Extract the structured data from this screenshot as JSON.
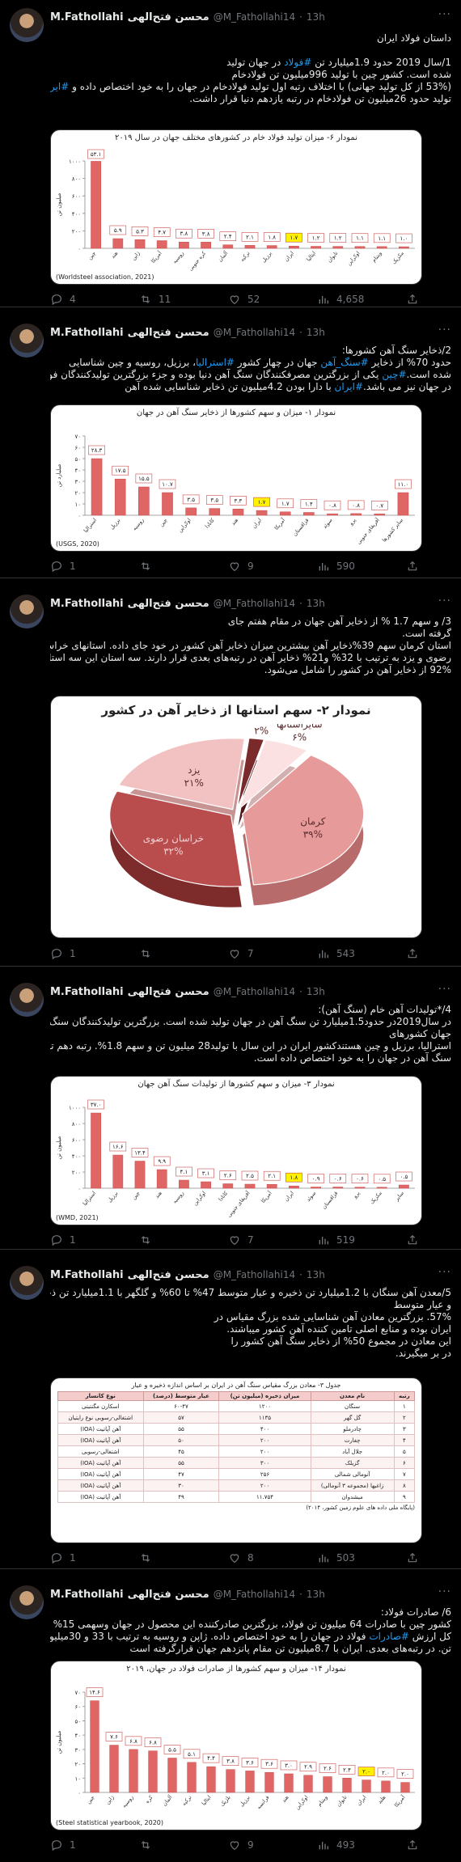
{
  "author": {
    "name": "M.Fathollahi",
    "display": "محسن فتح‌الهی",
    "handle": "@M_Fathollahi14",
    "time": "13h",
    "sep": "·"
  },
  "colors": {
    "bar": "#e06666",
    "bar_edge": "#c94b4b",
    "highlight": "#fff200",
    "link": "#1d9bf0"
  },
  "tweets": [
    {
      "text_lines": [
        "داستان فولاد ایران",
        "",
        "1/سال 2019 حدود 1.9میلیارد تن #فولاد در جهان تولید",
        "شده است. کشور چین با تولید 996میلیون تن فولادخام",
        "(53% از کل تولید جهانی) با اختلاف رتبه اول تولید فولادخام در جهان را به خود اختصاص داده و #ایران با",
        "تولید حدود 26میلیون تن فولادخام در رتبه یازدهم دنیا قرار داشت."
      ],
      "chart_title": "نمودار ۶- میزان تولید فولاد خام در کشورهای مختلف جهان در سال ۲۰۱۹",
      "source": "(Worldsteel association, 2021)",
      "metrics": {
        "reply": "4",
        "retweet": "11",
        "like": "52",
        "views": "4,658"
      }
    },
    {
      "text_lines": [
        "2/ذخایر سنگ آهن کشورها:",
        "حدود 70% از ذخایر #سنگ_آهن جهان در چهار کشور #استرالیا، برزیل، روسیه و چین شناسایی",
        "شده است.#چین یکی از بزرگترین مصرفکنندگان سنگ آهن دنیا بوده و جزء بزرگترین تولیدکنندگان فولاد",
        "در جهان نیز می باشد.#ایران با دارا بودن 4.2میلیون تن ذخایر شناسایی شده آهن"
      ],
      "chart_title": "نمودار ۱- میزان و سهم کشورها از ذخایر سنگ آهن در جهان",
      "source": "(USGS, 2020)",
      "metrics": {
        "reply": "1",
        "retweet": "",
        "like": "9",
        "views": "590"
      }
    },
    {
      "text_lines": [
        "3/ و سهم 1.7 % از ذخایر آهن جهان در مقام هفتم جای",
        "گرفته است.",
        "استان کرمان سهم 39%ذخایر آهن بیشترین میزان ذخایر آهن کشور در خود جای داده. استانهای خراسان",
        "رضوی و یزد به ترتیب با 32% و21% ذخایر آهن در رتبه‌های بعدی قرار دارند. سه استان این سه استان در مجموع",
        "92% از ذخایر آهن در کشور را شامل می‌شود."
      ],
      "chart_title": "نمودار ۲- سهم استانها از ذخایر آهن در کشور",
      "metrics": {
        "reply": "1",
        "retweet": "",
        "like": "7",
        "views": "543"
      }
    },
    {
      "text_lines": [
        "4/*تولیدات آهن خام (سنگ آهن):",
        "در سال2019در حدود1.5میلیارد تن سنگ آهن در جهان تولید شده است. بزرگترین تولیدکنندگان سنگ آهن در",
        "جهان کشورهای",
        "استرالیا، برزیل و چین هستندکشور ایران در این سال با تولید28 میلیون تن و سهم 1.8%. رتبه دهم تولید",
        "سنگ آهن در جهان را به خود اختصاص داده است."
      ],
      "chart_title": "نمودار ۳- میزان و سهم کشورها از تولیدات سنگ آهن جهان",
      "source": "(WMD, 2021)",
      "metrics": {
        "reply": "1",
        "retweet": "",
        "like": "7",
        "views": "519"
      }
    },
    {
      "text_lines": [
        "5/معدن آهن سنگان با 1.2میلیارد تن ذخیره و عیار متوسط 47% تا 60% و گلگهر با 1.1میلیارد تن ذخیره",
        "و عیار متوسط",
        "57%. بزرگترین معادن آهن شناسایی شده بزرگ مقیاس در",
        "ایران بوده و منابع اصلی تامین کننده آهن کشور میباشند.",
        "این معادن در مجموع 50% از ذخایر سنگ آهن کشور را",
        "در بر میگیرند."
      ],
      "chart_title": "جدول ۳- معادن بزرگ مقیاس سنگ آهن در ایران بر اساس اندازه ذخیره و عیار",
      "table_headers": [
        "رتبه",
        "نام معدن",
        "میزان ذخیره (میلیون تن)",
        "عیار متوسط (درصد)",
        "نوع کانسار"
      ],
      "table_rows": [
        [
          "۱",
          "سنگان",
          "۱۲۰۰",
          "۶۰-۴۷",
          "اسکارن مگنتیتی"
        ],
        [
          "۲",
          "گل گهر",
          "۱۱۳۵",
          "۵۷",
          "اشتغالی-رسوبی نوع رایتیان"
        ],
        [
          "۳",
          "چادرملو",
          "۴۰۰",
          "۵۵",
          "آهن آپاتیت (IOA)"
        ],
        [
          "۴",
          "چغارت",
          "۲۰۰",
          "۵۰",
          "آهن آپاتیت (IOA)"
        ],
        [
          "۵",
          "جلال آباد",
          "۲۰۰",
          "۴۵",
          "اشتغالی-رسوبی"
        ],
        [
          "۶",
          "گزیلک",
          "۳۰۰",
          "۵۵",
          "آهن آپاتیت (IOA)"
        ],
        [
          "۷",
          "آنومالی شمالی",
          "۲۵۶",
          "۴۷",
          "آهن آپاتیت (IOA)"
        ],
        [
          "۸",
          "زاغیها (مجموعه ۳ آنومالی)",
          "۲۰۰",
          "۳۰",
          "آهن آپاتیت (IOA)"
        ],
        [
          "۹",
          "میشدوان",
          "۱۱.۷۵۴",
          "۴۹",
          "آهن آپاتیت (IOA)"
        ]
      ],
      "table_source": "(پایگاه ملی داده های علوم زمین کشور، ۲۰۱۴)",
      "metrics": {
        "reply": "1",
        "retweet": "",
        "like": "8",
        "views": "503"
      }
    },
    {
      "text_lines": [
        "6/ صادرات فولاد:",
        "کشور چین با صادرات 64 میلیون تن فولاد، بزرگترین صادرکننده این محصول در جهان وسهمی 15% از",
        "کل ارزش #صادرات فولاد در جهان را به خود اختصاص داده. ژاپن و روسیه به ترتیب با 33 و 30میلیون",
        "تن. در رتبه‌های بعدی. ایران با 8.7میلیون تن مقام پانزدهم جهان قرارگرفته است"
      ],
      "chart_title": "نمودار ۱۴- میزان و سهم کشورها از صادرات فولاد در جهان، ۲۰۱۹",
      "source": "(Steel statistical yearbook, 2020)",
      "metrics": {
        "reply": "1",
        "retweet": "",
        "like": "9",
        "views": "493"
      }
    }
  ],
  "chart_data": [
    {
      "type": "bar",
      "title": "نمودار ۶- میزان تولید فولاد خام در کشورهای مختلف جهان در سال ۲۰۱۹",
      "ylabel": "میلیون تن",
      "ylim": [
        0,
        1000
      ],
      "yticks": [
        "۰",
        "۲۰۰",
        "۴۰۰",
        "۶۰۰",
        "۸۰۰",
        "۱۰۰۰"
      ],
      "categories": [
        "چین",
        "هند",
        "ژاپن",
        "آمریکا",
        "روسیه",
        "کره جنوبی",
        "آلمان",
        "ترکیه",
        "برزیل",
        "ایران",
        "ایتالیا",
        "تایوان",
        "اوکراین",
        "ویتنام",
        "مکزیک"
      ],
      "values": [
        996,
        111,
        99,
        88,
        72,
        71,
        40,
        34,
        32,
        26,
        23,
        22,
        21,
        20,
        18
      ],
      "labels": [
        "۵۳.۱",
        "۵.۹",
        "۵.۳",
        "۴.۷",
        "۳.۸",
        "۳.۸",
        "۲.۴",
        "۲.۱",
        "۱.۸",
        "۱.۷",
        "۱.۲",
        "۱.۲",
        "۱.۱",
        "۱.۱",
        "۱.۰"
      ],
      "highlight_index": 9
    },
    {
      "type": "bar",
      "title": "نمودار ۱- میزان و سهم کشورها از ذخایر سنگ آهن در جهان",
      "ylabel": "میلیارد تن",
      "ylim": [
        0,
        70
      ],
      "yticks": [
        "۰",
        "۱۰",
        "۲۰",
        "۳۰",
        "۴۰",
        "۵۰",
        "۶۰",
        "۷۰"
      ],
      "categories": [
        "استرالیا",
        "برزیل",
        "روسیه",
        "چین",
        "اوکراین",
        "کانادا",
        "هند",
        "ایران",
        "آمریکا",
        "قزاقستان",
        "سوئد",
        "پرو",
        "آفریقای جنوبی",
        "سایر کشورها"
      ],
      "values": [
        50,
        32,
        25,
        20,
        6.5,
        6,
        5.5,
        4.2,
        3,
        2.5,
        1.3,
        1.5,
        1.2,
        20
      ],
      "labels": [
        "۲۸.۳",
        "۱۷.۵",
        "۱۵.۵",
        "۱۰.۷",
        "۳.۵",
        "۳.۵",
        "۳.۳",
        "۱.۷",
        "۱.۷",
        "۱.۴",
        "۰.۸",
        "۰.۸",
        "۰.۷",
        "۱۱.۰"
      ],
      "highlight_index": 7
    },
    {
      "type": "pie",
      "title": "نمودار ۲- سهم استانها از ذخایر آهن در کشور",
      "slices": [
        {
          "label": "کرمان",
          "value": 39,
          "text": "۳۹%"
        },
        {
          "label": "خراسان رضوی",
          "value": 32,
          "text": "۳۲%"
        },
        {
          "label": "یزد",
          "value": 21,
          "text": "۲۱%"
        },
        {
          "label": "کردستان",
          "value": 2,
          "text": "۲%"
        },
        {
          "label": "سایراستانها",
          "value": 6,
          "text": "۶%"
        }
      ]
    },
    {
      "type": "bar",
      "title": "نمودار ۳- میزان و سهم کشورها از تولیدات سنگ آهن جهان",
      "ylabel": "میلیون تن",
      "ylim": [
        0,
        1000
      ],
      "yticks": [
        "۰",
        "۲۰۰",
        "۴۰۰",
        "۶۰۰",
        "۸۰۰",
        "۱۰۰۰"
      ],
      "categories": [
        "استرالیا",
        "برزیل",
        "چین",
        "هند",
        "روسیه",
        "اوکراین",
        "کانادا",
        "آفریقای جنوبی",
        "آمریکا",
        "ایران",
        "سوئد",
        "قزاقستان",
        "پرو",
        "مکزیک",
        "سایر"
      ],
      "values": [
        930,
        410,
        335,
        230,
        100,
        80,
        55,
        50,
        48,
        28,
        15,
        15,
        13,
        12,
        40
      ],
      "labels": [
        "۳۷.۰",
        "۱۶.۶",
        "۱۳.۴",
        "۹.۹",
        "۴.۱",
        "۳.۱",
        "۲.۶",
        "۲.۵",
        "۲.۱",
        "۱.۸",
        "۰.۹",
        "۰.۶",
        "۰.۶",
        "۰.۵",
        "۰.۵"
      ],
      "highlight_index": 9
    },
    {
      "type": "bar",
      "title": "نمودار ۱۴- میزان و سهم کشورها از صادرات فولاد در جهان، ۲۰۱۹",
      "ylabel": "میلیون تن",
      "ylim": [
        0,
        70
      ],
      "yticks": [
        "۰",
        "۱۰",
        "۲۰",
        "۳۰",
        "۴۰",
        "۵۰",
        "۶۰",
        "۷۰"
      ],
      "categories": [
        "چین",
        "ژاپن",
        "روسیه",
        "کره",
        "آلمان",
        "ترکیه",
        "ایتالیا",
        "بلژیک",
        "برزیل",
        "فرانسه",
        "هند",
        "اوکراین",
        "ویتنام",
        "تایوان",
        "ایران",
        "هلند",
        "آمریکا"
      ],
      "values": [
        64,
        33,
        30,
        29,
        24,
        21,
        18,
        16,
        15,
        14,
        13,
        12,
        11,
        10,
        8.7,
        8,
        7
      ],
      "labels": [
        "۱۴.۶",
        "۷.۶",
        "۶.۸",
        "۶.۸",
        "۵.۵",
        "۵.۱",
        "۴.۴",
        "۳.۸",
        "۳.۶",
        "۳.۶",
        "۳.۰",
        "۲.۹",
        "۲.۶",
        "۲.۴",
        "۲.۰",
        "۲.۰",
        "۲.۰"
      ],
      "highlight_index": 14
    }
  ]
}
